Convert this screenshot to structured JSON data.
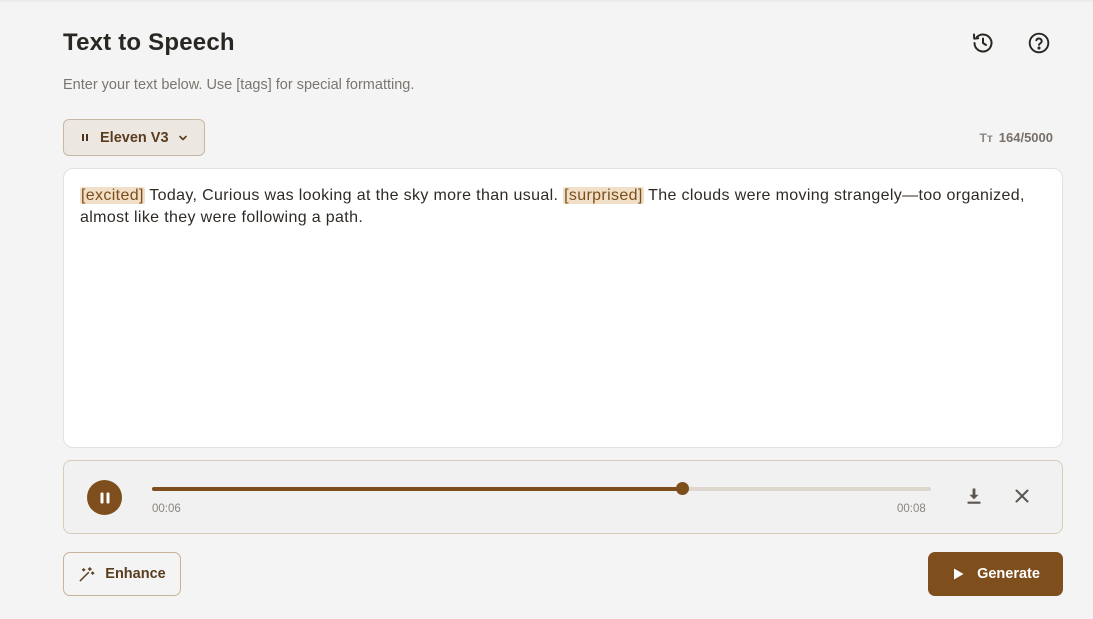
{
  "header": {
    "title": "Text to Speech",
    "subtitle": "Enter your text below. Use [tags] for special formatting."
  },
  "toolbar": {
    "history_icon": "history-icon",
    "help_icon": "help-circle-icon"
  },
  "model": {
    "selected": "Eleven V3",
    "icon": "model-bars-icon"
  },
  "char_count": {
    "icon_label": "Tт",
    "value": "164/5000"
  },
  "editor": {
    "segments": [
      {
        "type": "tag",
        "text": "[excited]"
      },
      {
        "type": "text",
        "text": " Today, Curious was looking at the sky more than usual. "
      },
      {
        "type": "tag",
        "text": "[surprised]"
      },
      {
        "type": "text",
        "text": " The clouds were moving strangely—too organized, almost like they were following a path."
      }
    ]
  },
  "player": {
    "current_time": "00:06",
    "total_time": "00:08",
    "progress": 0.68,
    "state": "playing"
  },
  "actions": {
    "enhance_label": "Enhance",
    "generate_label": "Generate"
  },
  "colors": {
    "accent": "#7e4e1c",
    "tag_bg": "#f1dfc8",
    "background": "#f4f4f4"
  }
}
